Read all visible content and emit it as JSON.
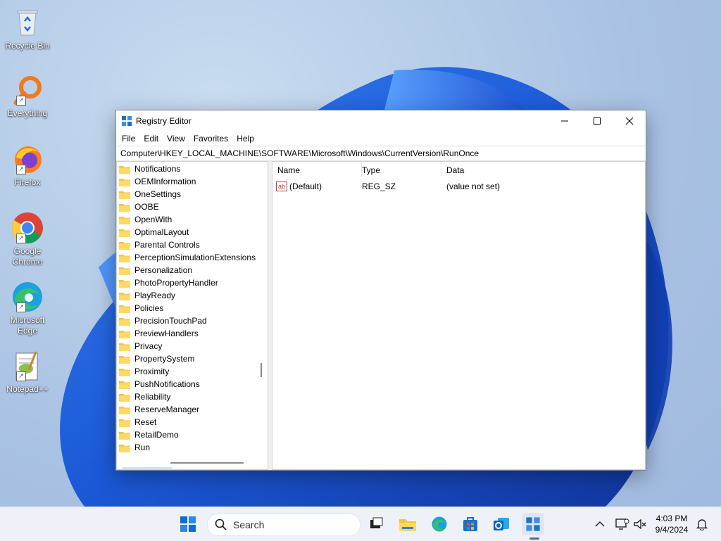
{
  "desktop": {
    "icons": [
      {
        "label": "Recycle Bin",
        "icon": "recycle-bin-icon"
      },
      {
        "label": "Everything",
        "icon": "everything-search-icon"
      },
      {
        "label": "Firefox",
        "icon": "firefox-icon"
      },
      {
        "label": "Google Chrome",
        "icon": "chrome-icon"
      },
      {
        "label": "Microsoft Edge",
        "icon": "edge-icon"
      },
      {
        "label": "Notepad++",
        "icon": "notepadpp-icon"
      }
    ]
  },
  "window": {
    "title": "Registry Editor",
    "menu": [
      "File",
      "Edit",
      "View",
      "Favorites",
      "Help"
    ],
    "address": "Computer\\HKEY_LOCAL_MACHINE\\SOFTWARE\\Microsoft\\Windows\\CurrentVersion\\RunOnce",
    "tree": [
      "Notifications",
      "OEMInformation",
      "OneSettings",
      "OOBE",
      "OpenWith",
      "OptimalLayout",
      "Parental Controls",
      "PerceptionSimulationExtensions",
      "Personalization",
      "PhotoPropertyHandler",
      "PlayReady",
      "Policies",
      "PrecisionTouchPad",
      "PreviewHandlers",
      "Privacy",
      "PropertySystem",
      "Proximity",
      "PushNotifications",
      "Reliability",
      "ReserveManager",
      "Reset",
      "RetailDemo",
      "Run"
    ],
    "columns": [
      "Name",
      "Type",
      "Data"
    ],
    "values": [
      {
        "name": "(Default)",
        "type": "REG_SZ",
        "data": "(value not set)"
      }
    ]
  },
  "taskbar": {
    "search_label": "Search",
    "time": "4:03 PM",
    "date": "9/4/2024"
  },
  "colors": {
    "folder": "#f2c14e",
    "accent": "#0067c0"
  }
}
